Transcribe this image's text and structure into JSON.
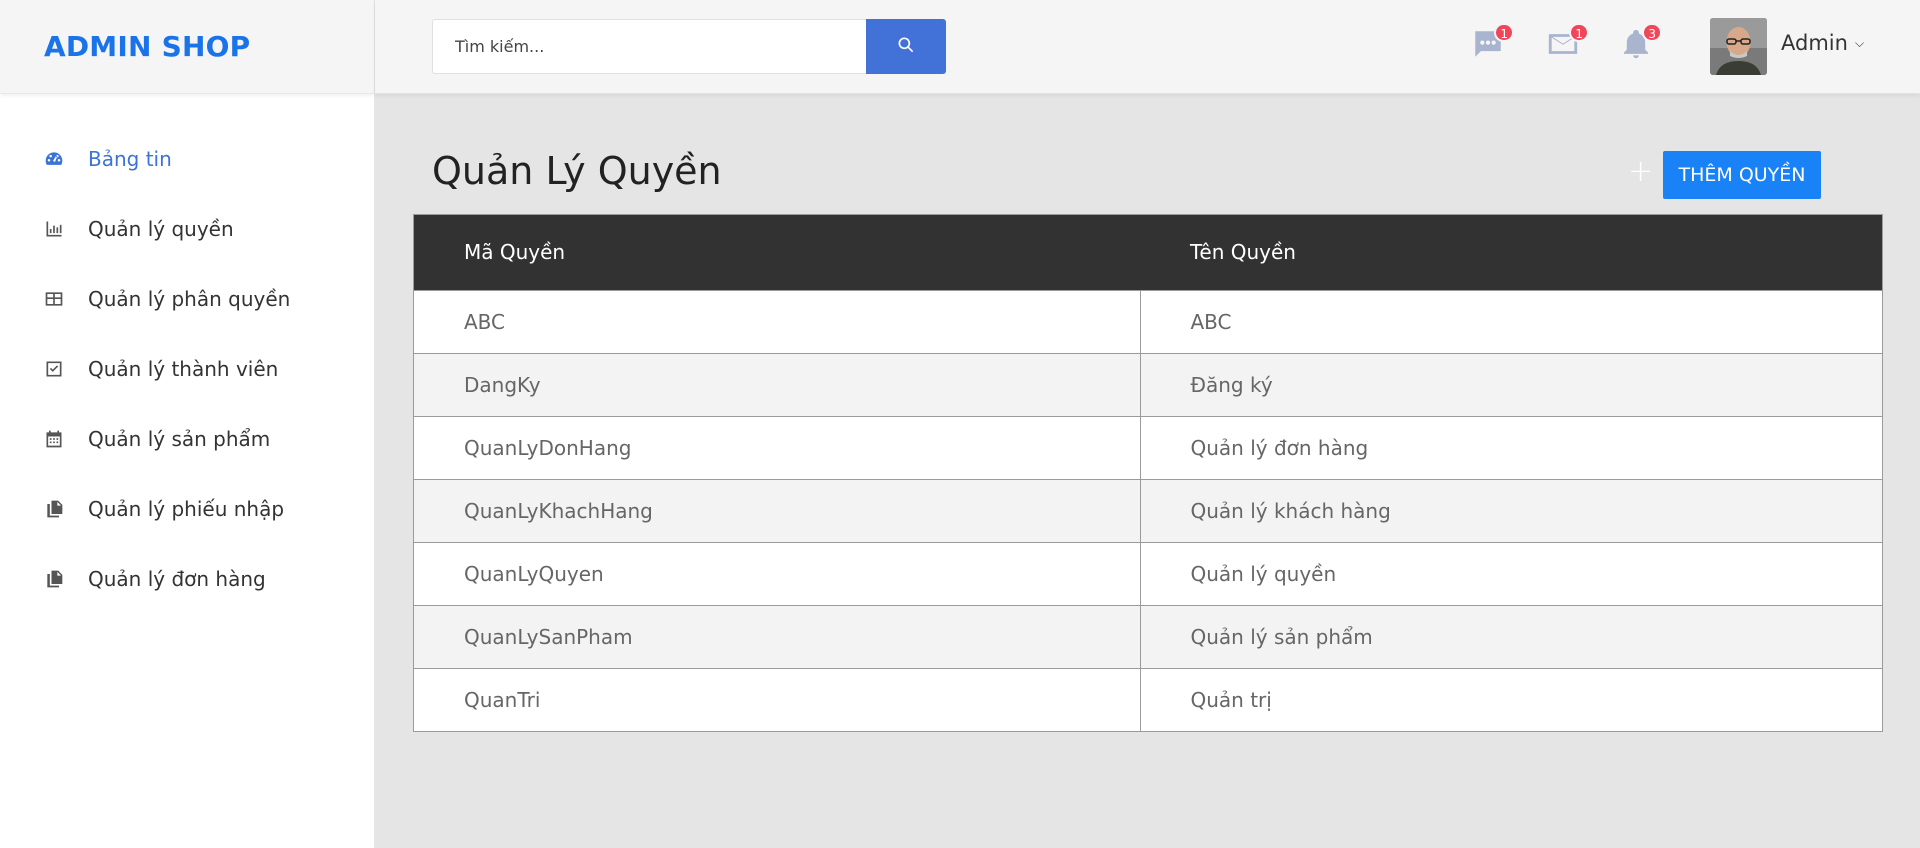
{
  "brand": {
    "logo_text": "ADMIN SHOP",
    "accent_color": "#1a73e8"
  },
  "sidebar": {
    "items": [
      {
        "label": "Bảng tin",
        "icon": "dashboard-icon",
        "active": true
      },
      {
        "label": "Quản lý quyền",
        "icon": "bar-chart-icon"
      },
      {
        "label": "Quản lý phân quyền",
        "icon": "table-icon"
      },
      {
        "label": "Quản lý thành viên",
        "icon": "checkbox-icon"
      },
      {
        "label": "Quản lý sản phẩm",
        "icon": "calendar-icon"
      },
      {
        "label": "Quản lý phiếu nhập",
        "icon": "copy-icon"
      },
      {
        "label": "Quản lý đơn hàng",
        "icon": "copy-icon"
      }
    ]
  },
  "header": {
    "search": {
      "placeholder": "Tìm kiếm...",
      "value": ""
    },
    "notifications": {
      "messages": {
        "icon": "chat-icon",
        "count": "1"
      },
      "mail": {
        "icon": "mail-icon",
        "count": "1"
      },
      "alerts": {
        "icon": "bell-icon",
        "count": "3"
      }
    },
    "user": {
      "name": "Admin",
      "avatar_icon": "user-avatar"
    }
  },
  "main": {
    "title": "Quản Lý Quyền",
    "add_button_label": "THÊM QUYỀN",
    "table": {
      "columns": [
        "Mã Quyền",
        "Tên Quyền"
      ],
      "rows": [
        [
          "ABC",
          "ABC"
        ],
        [
          "DangKy",
          "Đăng ký"
        ],
        [
          "QuanLyDonHang",
          "Quản lý đơn hàng"
        ],
        [
          "QuanLyKhachHang",
          "Quản lý khách hàng"
        ],
        [
          "QuanLyQuyen",
          "Quản lý quyền"
        ],
        [
          "QuanLySanPham",
          "Quản lý sản phẩm"
        ],
        [
          "QuanTri",
          "Quản trị"
        ]
      ]
    }
  }
}
